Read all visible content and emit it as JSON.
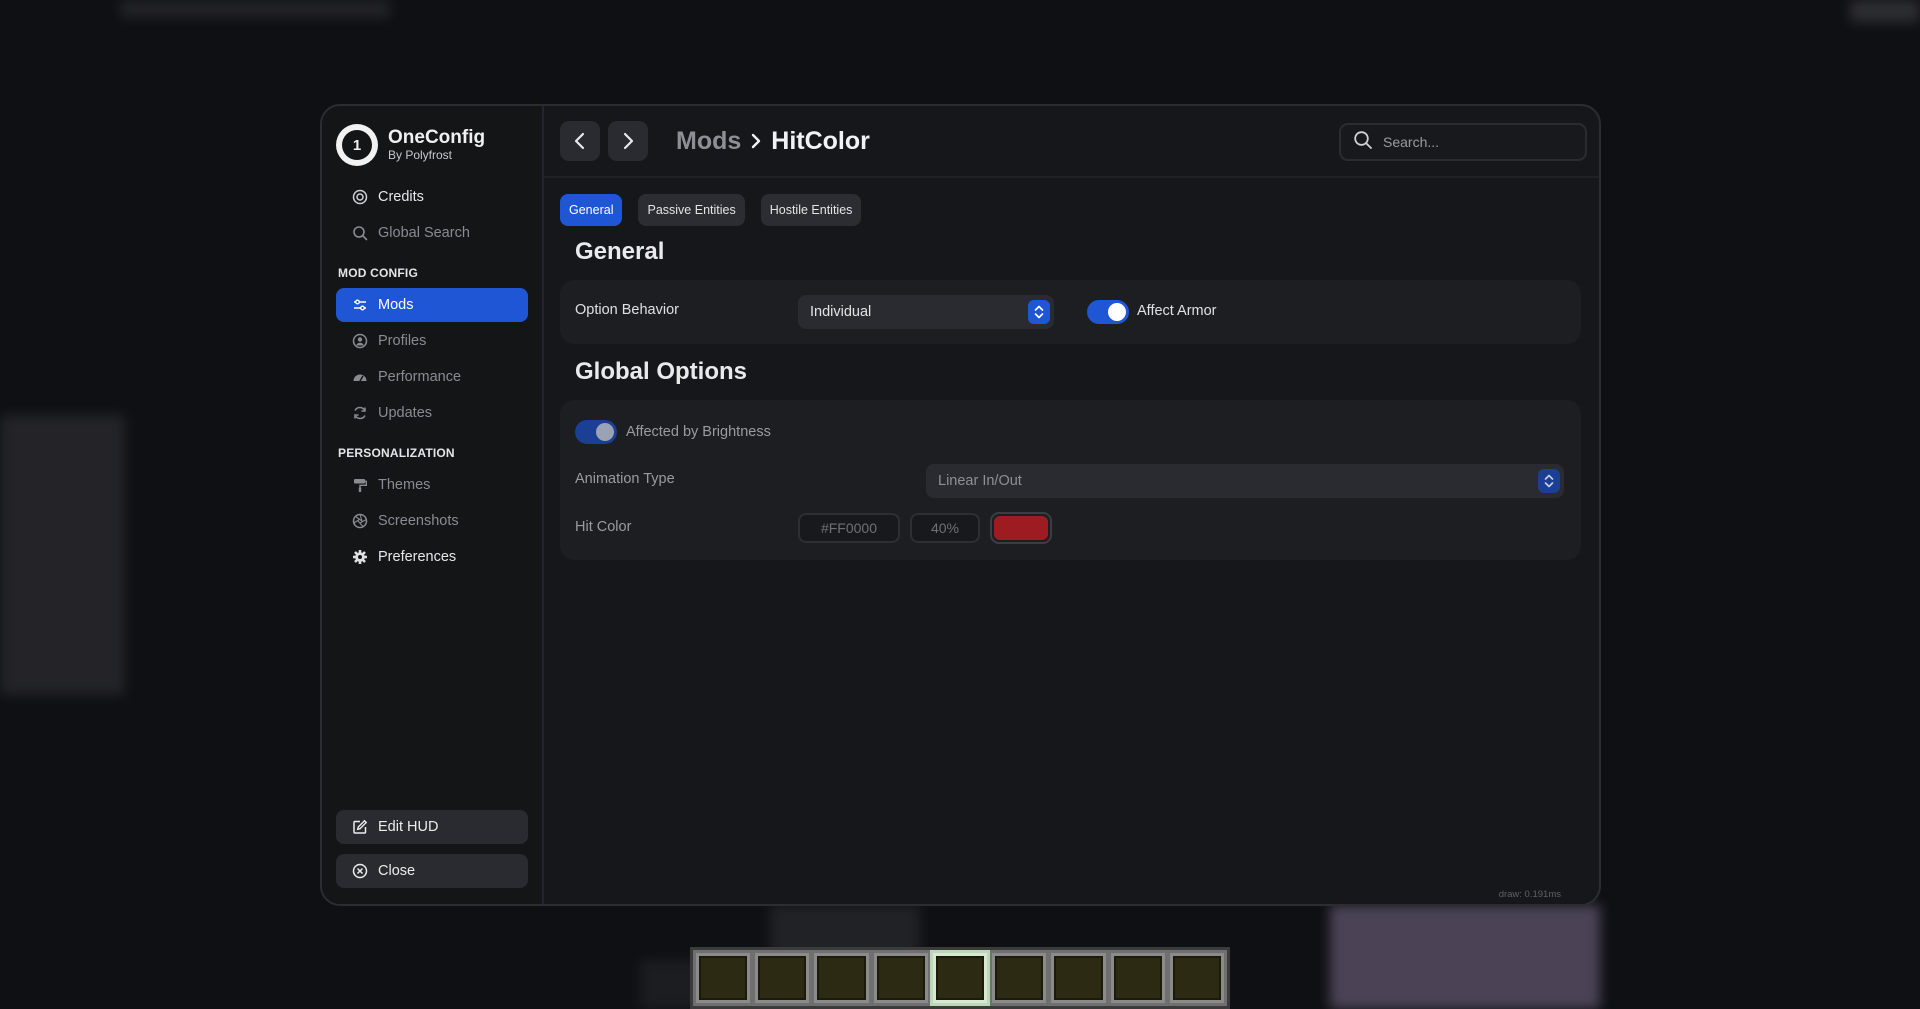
{
  "app": {
    "name": "OneConfig",
    "subtitle": "By Polyfrost"
  },
  "sidebar": {
    "top_items": [
      {
        "label": "Credits",
        "icon": "credits-icon"
      },
      {
        "label": "Global Search",
        "icon": "search-icon"
      }
    ],
    "sections": [
      {
        "title": "MOD CONFIG",
        "items": [
          {
            "label": "Mods",
            "icon": "sliders-icon",
            "active": true
          },
          {
            "label": "Profiles",
            "icon": "profiles-icon"
          },
          {
            "label": "Performance",
            "icon": "speedometer-icon"
          },
          {
            "label": "Updates",
            "icon": "refresh-icon"
          }
        ]
      },
      {
        "title": "PERSONALIZATION",
        "items": [
          {
            "label": "Themes",
            "icon": "paint-roller-icon"
          },
          {
            "label": "Screenshots",
            "icon": "aperture-icon"
          },
          {
            "label": "Preferences",
            "icon": "gear-icon"
          }
        ]
      }
    ],
    "bottom_buttons": [
      {
        "label": "Edit HUD",
        "icon": "edit-icon"
      },
      {
        "label": "Close",
        "icon": "close-circle-icon"
      }
    ]
  },
  "header": {
    "breadcrumb_parent": "Mods",
    "breadcrumb_current": "HitColor",
    "search_placeholder": "Search..."
  },
  "tabs": [
    {
      "label": "General",
      "active": true
    },
    {
      "label": "Passive Entities",
      "active": false
    },
    {
      "label": "Hostile Entities",
      "active": false
    }
  ],
  "general": {
    "title": "General",
    "option_behavior_label": "Option Behavior",
    "option_behavior_value": "Individual",
    "affect_armor_label": "Affect Armor",
    "affect_armor_on": true
  },
  "global_options": {
    "title": "Global Options",
    "brightness_label": "Affected by Brightness",
    "brightness_on": true,
    "animation_label": "Animation Type",
    "animation_value": "Linear In/Out",
    "hit_color_label": "Hit Color",
    "hit_color_hex": "#FF0000",
    "hit_color_alpha": "40%",
    "hit_color_swatch": "#9d1c22"
  },
  "footer": {
    "draw_time": "draw: 0.191ms"
  },
  "colors": {
    "accent": "#1e56d6",
    "panel": "#16171a",
    "card": "#1d1e22"
  }
}
